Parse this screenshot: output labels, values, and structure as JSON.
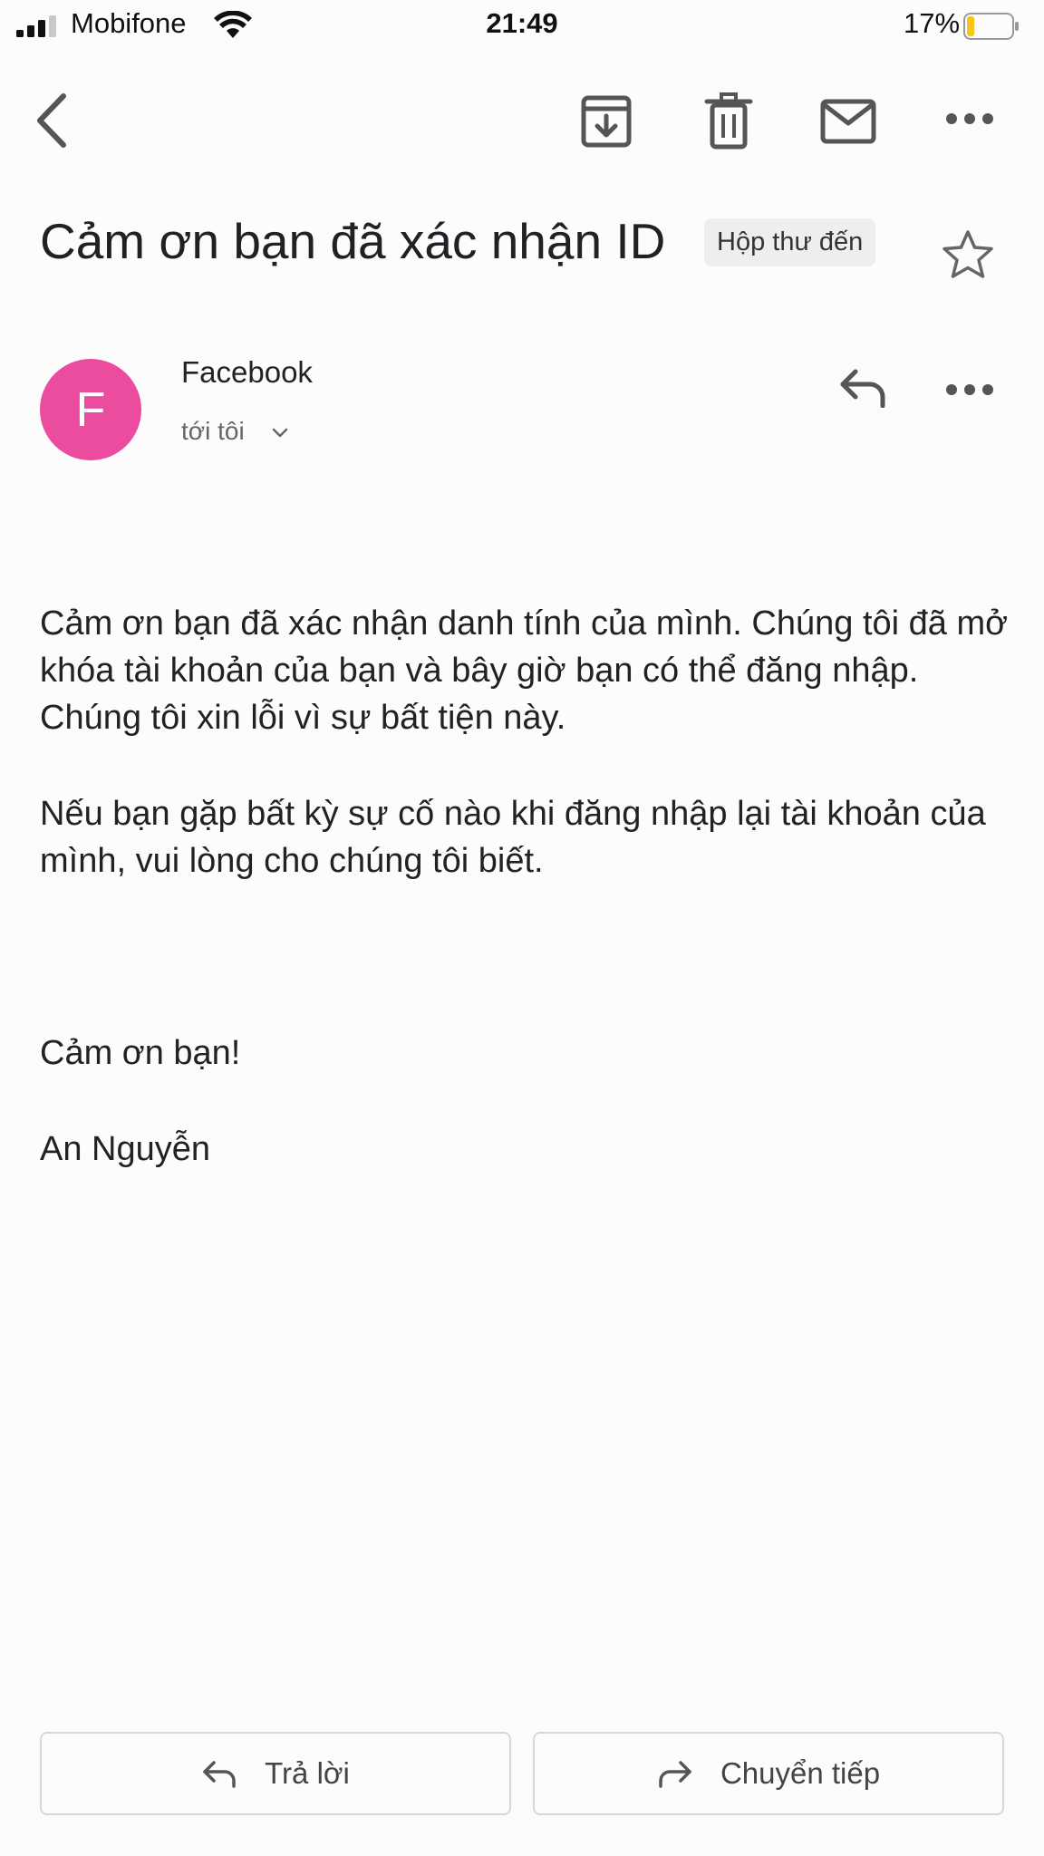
{
  "status_bar": {
    "carrier": "Mobifone",
    "time": "21:49",
    "battery_percent": "17%",
    "battery_level": 0.17,
    "battery_color": "#f5c518",
    "signal_bars": 3
  },
  "toolbar": {
    "icons": [
      "back-icon",
      "archive-icon",
      "trash-icon",
      "mail-icon",
      "more-icon"
    ]
  },
  "email": {
    "subject": "Cảm ơn bạn đã xác nhận ID",
    "label": "Hộp thư đến",
    "starred": false,
    "sender": {
      "name": "Facebook",
      "initial": "F",
      "avatar_color": "#ec4c9e",
      "recipient": "tới tôi"
    },
    "body": {
      "paragraph1": "Cảm ơn bạn đã xác nhận danh tính của mình. Chúng tôi đã mở khóa tài khoản của bạn và bây giờ bạn có thể đăng nhập. Chúng tôi xin lỗi vì sự bất tiện này.",
      "paragraph2": "Nếu bạn gặp bất kỳ sự cố nào khi đăng nhập lại tài khoản của mình, vui lòng cho chúng tôi biết.",
      "closing": "Cảm ơn bạn!",
      "signature": "An Nguyễn"
    }
  },
  "actions": {
    "reply_label": "Trả lời",
    "forward_label": "Chuyển tiếp"
  }
}
